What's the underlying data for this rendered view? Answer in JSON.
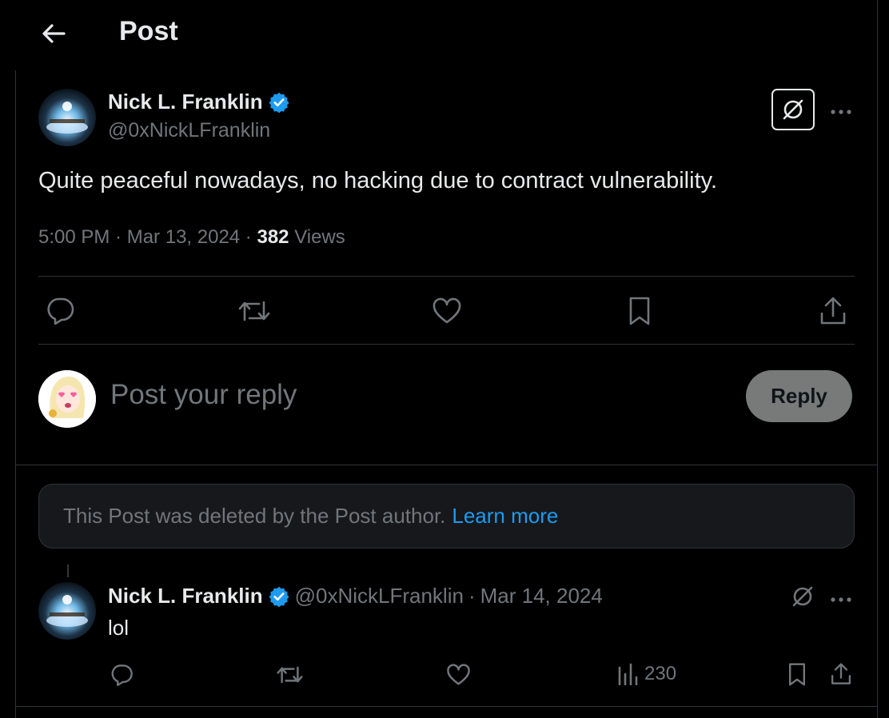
{
  "header": {
    "title": "Post",
    "back_icon": "arrow-left-icon"
  },
  "post": {
    "author_name": "Nick L. Franklin",
    "author_handle": "@0xNickLFranklin",
    "verified_color": "#1d9bf0",
    "text": "Quite peaceful nowadays, no hacking due to contract vulnerability.",
    "time": "5:00 PM",
    "date": "Mar 13, 2024",
    "views_count": "382",
    "views_label": "Views",
    "separator": " · ",
    "more_icon": "more-horizontal-icon",
    "grok_icon": "grok-slash-icon",
    "actions": [
      "reply-icon",
      "repost-icon",
      "like-icon",
      "bookmark-icon",
      "share-icon"
    ]
  },
  "composer": {
    "placeholder": "Post your reply",
    "button_label": "Reply"
  },
  "deleted_notice": {
    "text": "This Post was deleted by the Post author.",
    "link": "Learn more"
  },
  "reply": {
    "author_name": "Nick L. Franklin",
    "author_handle": "@0xNickLFranklin",
    "date": "Mar 14, 2024",
    "separator": " · ",
    "text": "lol",
    "views": "230"
  },
  "colors": {
    "background": "#000000",
    "text_primary": "#e7e9ea",
    "text_secondary": "#71767b",
    "accent": "#1d9bf0",
    "divider": "#2f3336"
  }
}
